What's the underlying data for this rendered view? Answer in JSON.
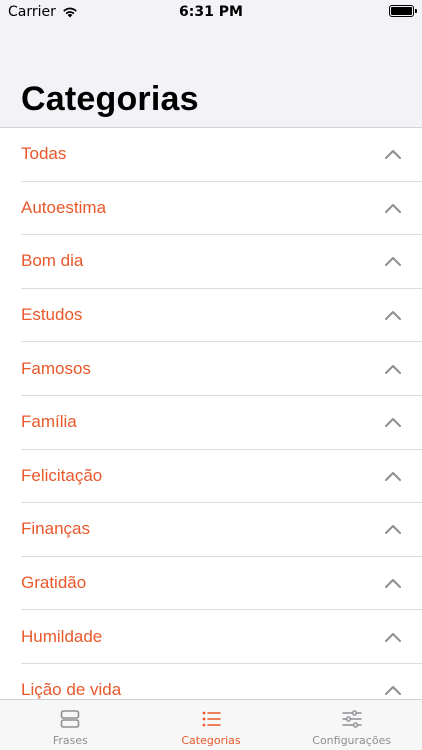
{
  "status_bar": {
    "carrier": "Carrier",
    "time": "6:31 PM"
  },
  "header": {
    "title": "Categorias"
  },
  "categories": [
    {
      "label": "Todas"
    },
    {
      "label": "Autoestima"
    },
    {
      "label": "Bom dia"
    },
    {
      "label": "Estudos"
    },
    {
      "label": "Famosos"
    },
    {
      "label": "Família"
    },
    {
      "label": "Felicitação"
    },
    {
      "label": "Finanças"
    },
    {
      "label": "Gratidão"
    },
    {
      "label": "Humildade"
    },
    {
      "label": "Lição de vida"
    }
  ],
  "tab_bar": {
    "tabs": [
      {
        "label": "Frases",
        "icon": "cards-icon",
        "active": false
      },
      {
        "label": "Categorias",
        "icon": "list-icon",
        "active": true
      },
      {
        "label": "Configurações",
        "icon": "sliders-icon",
        "active": false
      }
    ]
  },
  "colors": {
    "accent": "#e8582a",
    "inactive": "#8e8e93",
    "header_bg": "#f2f2f7"
  }
}
